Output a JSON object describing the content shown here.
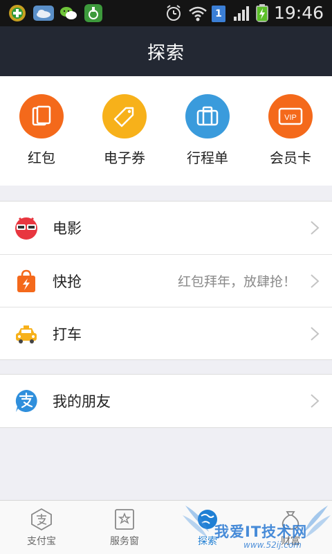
{
  "status_bar": {
    "time": "19:46",
    "sim_slot": "1",
    "icons": [
      "app-green-cross-icon",
      "weather-cloud-icon",
      "wechat-icon",
      "green-app-icon",
      "alarm-icon",
      "wifi-icon",
      "sim-card-icon",
      "signal-icon",
      "battery-charging-icon"
    ]
  },
  "header": {
    "title": "探索"
  },
  "tools": [
    {
      "label": "红包",
      "icon": "red-packet-icon",
      "color": "#f4691b"
    },
    {
      "label": "电子券",
      "icon": "coupon-tag-icon",
      "color": "#f7b11a"
    },
    {
      "label": "行程单",
      "icon": "suitcase-icon",
      "color": "#3a9bdc"
    },
    {
      "label": "会员卡",
      "icon": "vip-card-icon",
      "color": "#f4691b",
      "badge": "VIP"
    }
  ],
  "list_group_1": [
    {
      "label": "电影",
      "icon": "movie-mascot-icon"
    },
    {
      "label": "快抢",
      "icon": "shopping-bag-icon",
      "subtitle": "红包拜年，放肆抢！"
    },
    {
      "label": "打车",
      "icon": "taxi-icon"
    }
  ],
  "list_group_2": [
    {
      "label": "我的朋友",
      "icon": "alipay-friends-icon"
    }
  ],
  "tab_bar": [
    {
      "label": "支付宝",
      "icon": "alipay-tab-icon",
      "active": false
    },
    {
      "label": "服务窗",
      "icon": "service-window-icon",
      "active": false
    },
    {
      "label": "探索",
      "icon": "explore-globe-icon",
      "active": true
    },
    {
      "label": "财富",
      "icon": "wealth-icon",
      "active": false
    }
  ],
  "watermark": {
    "text": "我爱IT技术网",
    "url": "www.52ij.com"
  },
  "colors": {
    "header_bg": "#232833",
    "accent_blue": "#1f7fd4",
    "orange": "#f4691b",
    "yellow": "#f7b11a",
    "blue": "#3a9bdc"
  }
}
